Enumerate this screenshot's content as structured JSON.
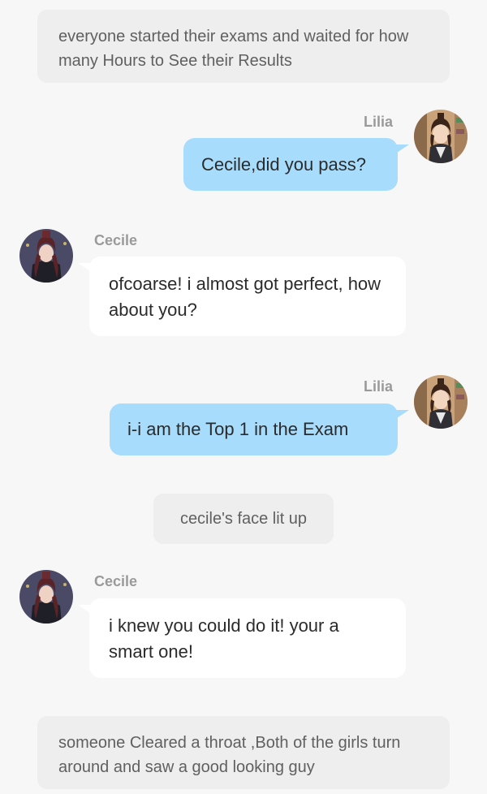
{
  "narrations": [
    {
      "text": "everyone started their exams and waited for how many Hours to See their Results"
    },
    {
      "text": "cecile's face lit up"
    },
    {
      "text": "someone Cleared a throat ,Both of the girls turn around and saw a good looking guy"
    }
  ],
  "characters": {
    "lilia": {
      "name": "Lilia",
      "avatar_icon": "lilia-avatar"
    },
    "cecile": {
      "name": "Cecile",
      "avatar_icon": "cecile-avatar"
    }
  },
  "messages": [
    {
      "speaker": "Lilia",
      "text": "Cecile,did you pass?"
    },
    {
      "speaker": "Cecile",
      "text": "ofcoarse!  i almost got perfect, how about you?"
    },
    {
      "speaker": "Lilia",
      "text": "i-i  am the Top 1 in the Exam"
    },
    {
      "speaker": "Cecile",
      "text": "i knew you could do it! your a smart one!"
    }
  ],
  "colors": {
    "background": "#f7f7f7",
    "narration_bg": "#eeeeee",
    "blue_bubble": "#a8dcfc",
    "white_bubble": "#ffffff",
    "name_text": "#9a9a9a"
  }
}
